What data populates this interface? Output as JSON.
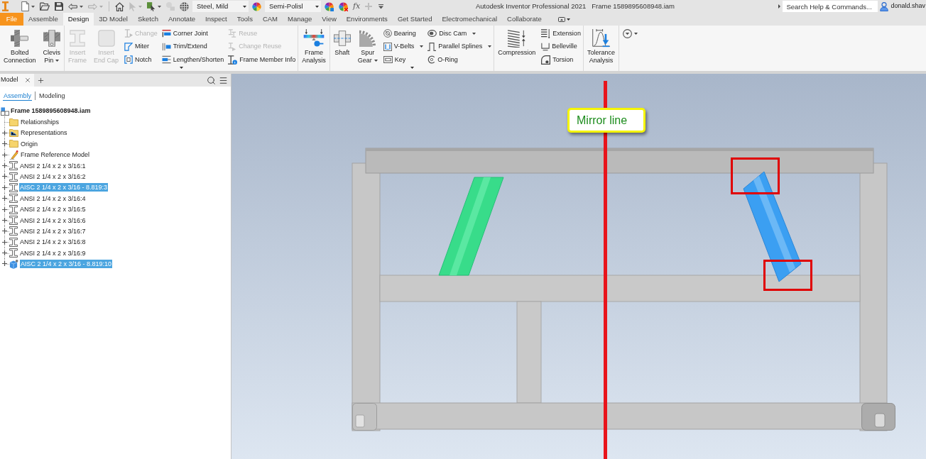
{
  "app": {
    "title": "Autodesk Inventor Professional 2021",
    "document": "Frame 1589895608948.iam"
  },
  "quick_access": [
    {
      "kind": "tool",
      "dropdown": true,
      "disabled": false
    },
    {
      "kind": "tool",
      "dropdown": false,
      "disabled": false
    },
    {
      "kind": "tool",
      "dropdown": false,
      "disabled": false
    },
    {
      "kind": "tool",
      "dropdown": true,
      "disabled": false
    },
    {
      "kind": "tool",
      "dropdown": true,
      "disabled": true
    },
    {
      "kind": "tool",
      "dropdown": false,
      "disabled": false
    },
    {
      "kind": "tool",
      "dropdown": true,
      "disabled": true
    },
    {
      "kind": "tool",
      "dropdown": true,
      "disabled": false
    },
    {
      "kind": "tool",
      "dropdown": false,
      "disabled": true
    },
    {
      "kind": "tool",
      "dropdown": false,
      "disabled": false
    },
    {
      "kind": "combo",
      "value": "Steel, Mild"
    },
    {
      "kind": "tool",
      "dropdown": false,
      "disabled": false
    },
    {
      "kind": "combo",
      "value": "Semi-Polisl"
    },
    {
      "kind": "tool",
      "dropdown": false,
      "disabled": false
    },
    {
      "kind": "tool",
      "dropdown": false,
      "disabled": false
    },
    {
      "kind": "text",
      "label": "fx"
    },
    {
      "kind": "tool",
      "dropdown": false,
      "disabled": true
    }
  ],
  "search": {
    "placeholder": "Search Help & Commands..."
  },
  "user": {
    "name": "donald.shav"
  },
  "tabs": [
    {
      "label": "File",
      "kind": "file",
      "selected": false
    },
    {
      "label": "Assemble",
      "kind": "tab",
      "selected": false
    },
    {
      "label": "Design",
      "kind": "tab",
      "selected": true
    },
    {
      "label": "3D Model",
      "kind": "tab",
      "selected": false
    },
    {
      "label": "Sketch",
      "kind": "tab",
      "selected": false
    },
    {
      "label": "Annotate",
      "kind": "tab",
      "selected": false
    },
    {
      "label": "Inspect",
      "kind": "tab",
      "selected": false
    },
    {
      "label": "Tools",
      "kind": "tab",
      "selected": false
    },
    {
      "label": "CAM",
      "kind": "tab",
      "selected": false
    },
    {
      "label": "Manage",
      "kind": "tab",
      "selected": false
    },
    {
      "label": "View",
      "kind": "tab",
      "selected": false
    },
    {
      "label": "Environments",
      "kind": "tab",
      "selected": false
    },
    {
      "label": "Get Started",
      "kind": "tab",
      "selected": false
    },
    {
      "label": "Electromechanical",
      "kind": "tab",
      "selected": false
    },
    {
      "label": "Collaborate",
      "kind": "tab",
      "selected": false
    }
  ],
  "ribbon": {
    "panels": [
      {
        "expandable": false,
        "tools": [
          {
            "kind": "large",
            "label": [
              "Bolted",
              "Connection"
            ],
            "dropdown": false,
            "disabled": false
          },
          {
            "kind": "large",
            "label": [
              "Clevis",
              "Pin"
            ],
            "dropdown": true,
            "disabled": false
          }
        ]
      },
      {
        "expandable": true,
        "tools": [
          {
            "kind": "large",
            "label": [
              "Insert",
              "Frame"
            ],
            "dropdown": false,
            "disabled": true
          },
          {
            "kind": "large",
            "label": [
              "Insert",
              "End Cap"
            ],
            "dropdown": false,
            "disabled": true
          },
          {
            "kind": "stack",
            "items": [
              {
                "label": "Change",
                "dropdown": false,
                "disabled": true
              },
              {
                "label": "Miter",
                "dropdown": false,
                "disabled": false
              },
              {
                "label": "Notch",
                "dropdown": false,
                "disabled": false
              }
            ]
          },
          {
            "kind": "stack",
            "items": [
              {
                "label": "Corner Joint",
                "dropdown": false,
                "disabled": false
              },
              {
                "label": "Trim/Extend",
                "dropdown": false,
                "disabled": false
              },
              {
                "label": "Lengthen/Shorten",
                "dropdown": false,
                "disabled": false
              }
            ]
          },
          {
            "kind": "stack",
            "items": [
              {
                "label": "Reuse",
                "dropdown": false,
                "disabled": true
              },
              {
                "label": "Change Reuse",
                "dropdown": false,
                "disabled": true
              },
              {
                "label": "Frame Member Info",
                "dropdown": false,
                "disabled": false
              }
            ]
          }
        ]
      },
      {
        "expandable": false,
        "tools": [
          {
            "kind": "large",
            "label": [
              "Frame",
              "Analysis"
            ],
            "dropdown": false,
            "disabled": false
          }
        ]
      },
      {
        "expandable": true,
        "tools": [
          {
            "kind": "large",
            "label": [
              "Shaft"
            ],
            "dropdown": false,
            "disabled": false
          },
          {
            "kind": "large",
            "label": [
              "Spur",
              "Gear"
            ],
            "dropdown": true,
            "disabled": false
          },
          {
            "kind": "stack",
            "items": [
              {
                "label": "Bearing",
                "dropdown": false,
                "disabled": false
              },
              {
                "label": "V-Belts",
                "dropdown": true,
                "disabled": false
              },
              {
                "label": "Key",
                "dropdown": false,
                "disabled": false
              }
            ]
          },
          {
            "kind": "stack",
            "items": [
              {
                "label": "Disc Cam",
                "dropdown": true,
                "disabled": false
              },
              {
                "label": "Parallel Splines",
                "dropdown": true,
                "disabled": false
              },
              {
                "label": "O-Ring",
                "dropdown": false,
                "disabled": false
              }
            ]
          }
        ]
      },
      {
        "expandable": false,
        "tools": [
          {
            "kind": "large",
            "label": [
              "Compression"
            ],
            "dropdown": false,
            "disabled": false
          },
          {
            "kind": "stack",
            "items": [
              {
                "label": "Extension",
                "dropdown": false,
                "disabled": false
              },
              {
                "label": "Belleville",
                "dropdown": false,
                "disabled": false
              },
              {
                "label": "Torsion",
                "dropdown": false,
                "disabled": false
              }
            ]
          }
        ]
      },
      {
        "expandable": false,
        "tools": [
          {
            "kind": "large",
            "label": [
              "Tolerance",
              "Analysis"
            ],
            "dropdown": false,
            "disabled": false
          }
        ]
      }
    ]
  },
  "browser": {
    "title": "Model",
    "views": [
      {
        "label": "Assembly",
        "selected": true
      },
      {
        "label": "Modeling",
        "selected": false
      }
    ],
    "root": {
      "label": "Frame 1589895608948.iam",
      "children": [
        {
          "label": "Relationships",
          "kind": "folder",
          "expandable": false,
          "selected": false
        },
        {
          "label": "Representations",
          "kind": "representations",
          "expandable": true,
          "selected": false
        },
        {
          "label": "Origin",
          "kind": "folder",
          "expandable": true,
          "selected": false
        },
        {
          "label": "Frame Reference Model",
          "kind": "reference",
          "expandable": true,
          "selected": false
        },
        {
          "label": "ANSI 2 1/4 x 2 x 3/16:1",
          "kind": "member",
          "expandable": true,
          "selected": false
        },
        {
          "label": "ANSI 2 1/4 x 2 x 3/16:2",
          "kind": "member",
          "expandable": true,
          "selected": false
        },
        {
          "label": "AISC 2 1/4 x 2 x 3/16 - 8.819:3",
          "kind": "member",
          "expandable": true,
          "selected": true
        },
        {
          "label": "ANSI 2 1/4 x 2 x 3/16:4",
          "kind": "member",
          "expandable": true,
          "selected": false
        },
        {
          "label": "ANSI 2 1/4 x 2 x 3/16:5",
          "kind": "member",
          "expandable": true,
          "selected": false
        },
        {
          "label": "ANSI 2 1/4 x 2 x 3/16:6",
          "kind": "member",
          "expandable": true,
          "selected": false
        },
        {
          "label": "ANSI 2 1/4 x 2 x 3/16:7",
          "kind": "member",
          "expandable": true,
          "selected": false
        },
        {
          "label": "ANSI 2 1/4 x 2 x 3/16:8",
          "kind": "member",
          "expandable": true,
          "selected": false
        },
        {
          "label": "ANSI 2 1/4 x 2 x 3/16:9",
          "kind": "member",
          "expandable": true,
          "selected": false
        },
        {
          "label": "AISC 2 1/4 x 2 x 3/16 - 8.819:10",
          "kind": "part",
          "expandable": true,
          "selected": true
        }
      ]
    }
  },
  "viewport": {
    "callout": "Mirror line"
  }
}
